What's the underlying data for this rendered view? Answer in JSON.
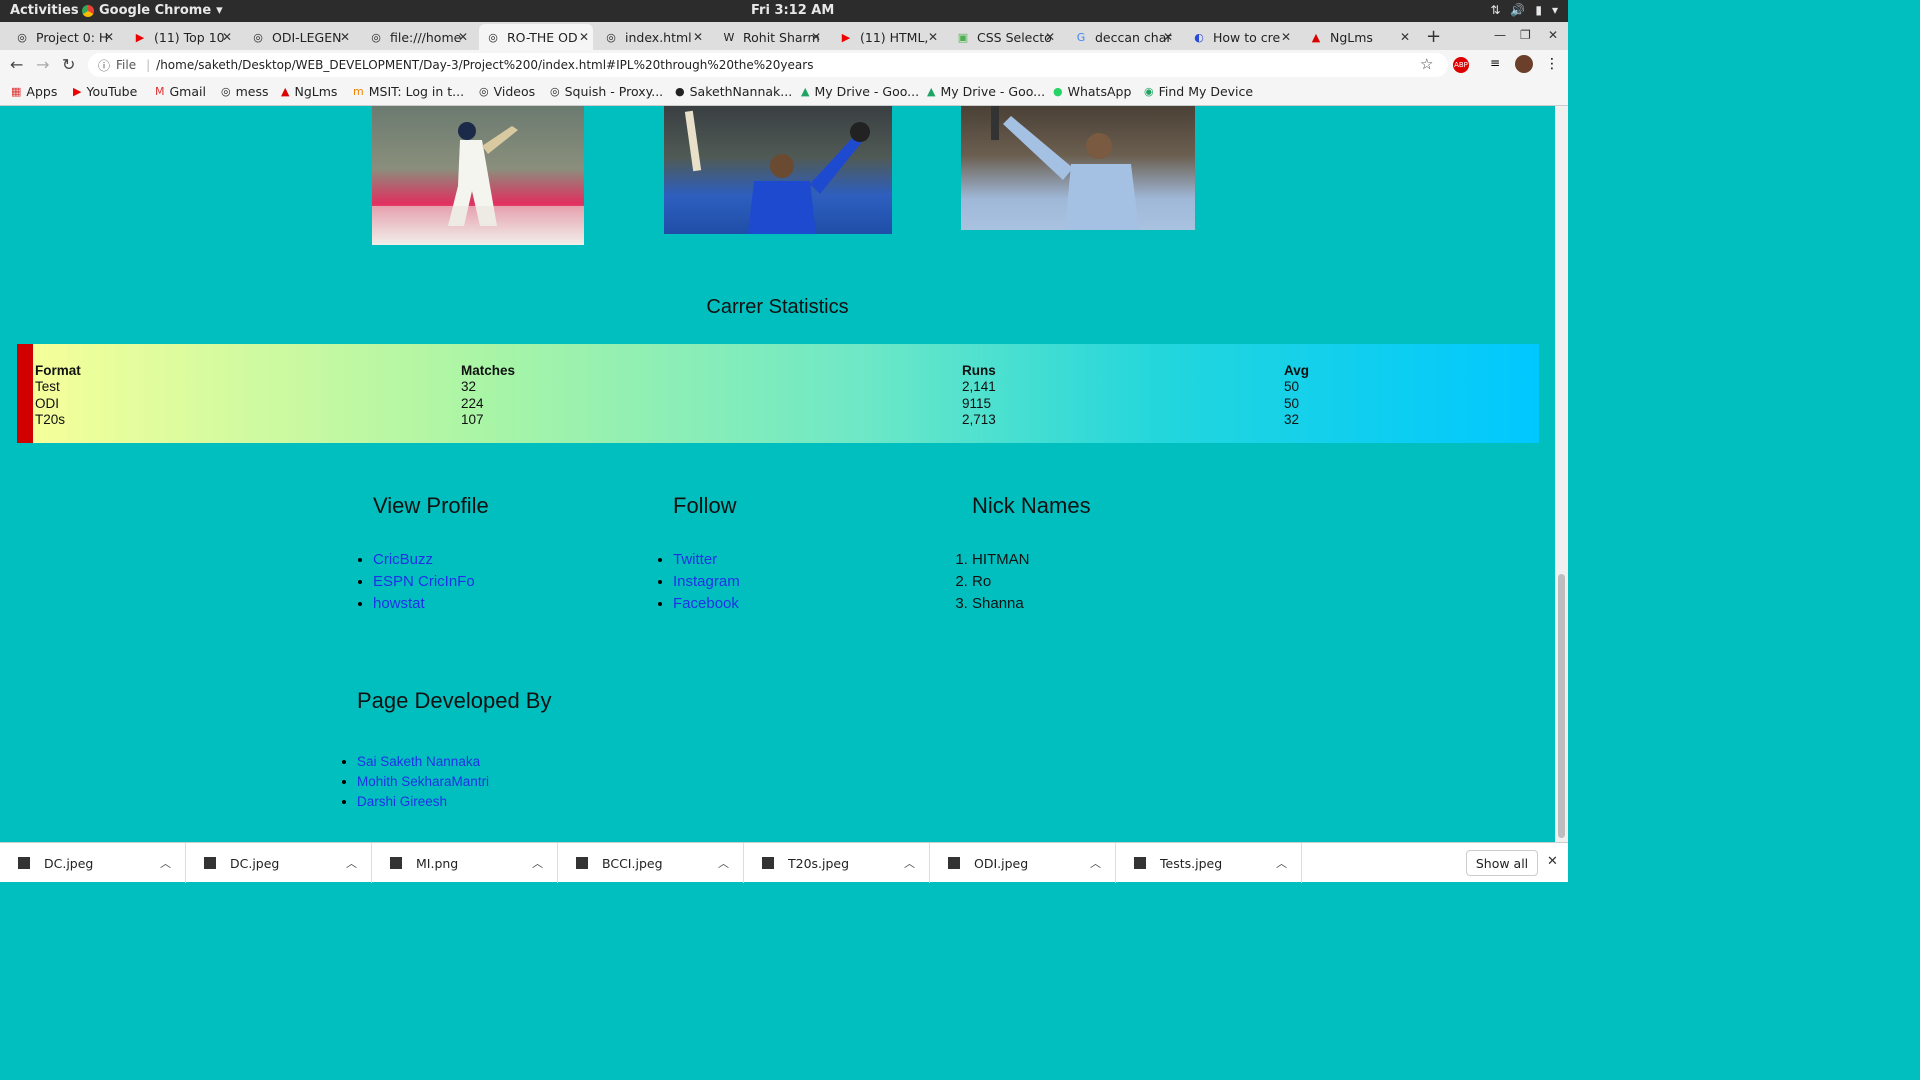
{
  "os": {
    "activities": "Activities",
    "app_name": "Google Chrome",
    "clock": "Fri  3:12 AM"
  },
  "tabs": [
    {
      "label": "Project 0: H",
      "icon": "globe-icon"
    },
    {
      "label": "(11) Top 10",
      "icon": "youtube-icon"
    },
    {
      "label": "ODI-LEGEN",
      "icon": "globe-icon"
    },
    {
      "label": "file:///home",
      "icon": "globe-icon"
    },
    {
      "label": "RO-THE OD",
      "icon": "globe-icon"
    },
    {
      "label": "index.html",
      "icon": "globe-icon"
    },
    {
      "label": "Rohit Sharm",
      "icon": "wikipedia-icon"
    },
    {
      "label": "(11) HTML,",
      "icon": "youtube-icon"
    },
    {
      "label": "CSS Selecto",
      "icon": "w3schools-icon"
    },
    {
      "label": "deccan char",
      "icon": "google-icon"
    },
    {
      "label": "How to cre",
      "icon": "globe-icon"
    },
    {
      "label": "NgLms",
      "icon": "angular-icon"
    }
  ],
  "address": {
    "file_label": "File",
    "url": "/home/saketh/Desktop/WEB_DEVELOPMENT/Day-3/Project%200/index.html#IPL%20through%20the%20years"
  },
  "bookmarks": [
    {
      "label": "Apps",
      "icon": "apps-grid-icon"
    },
    {
      "label": "YouTube",
      "icon": "youtube-icon"
    },
    {
      "label": "Gmail",
      "icon": "gmail-icon"
    },
    {
      "label": "mess",
      "icon": "globe-icon"
    },
    {
      "label": "NgLms",
      "icon": "angular-icon"
    },
    {
      "label": "MSIT: Log in t...",
      "icon": "moodle-icon"
    },
    {
      "label": "Videos",
      "icon": "globe-icon"
    },
    {
      "label": "Squish - Proxy...",
      "icon": "globe-icon"
    },
    {
      "label": "SakethNannak...",
      "icon": "github-icon"
    },
    {
      "label": "My Drive - Goo...",
      "icon": "drive-icon"
    },
    {
      "label": "My Drive - Goo...",
      "icon": "drive-icon"
    },
    {
      "label": "WhatsApp",
      "icon": "whatsapp-icon"
    },
    {
      "label": "Find My Device",
      "icon": "find-device-icon"
    }
  ],
  "stats": {
    "title": "Carrer Statistics",
    "headers": [
      "Format",
      "Matches",
      "Runs",
      "Avg"
    ],
    "rows": [
      [
        "Test",
        "32",
        "2,141",
        "50"
      ],
      [
        "ODI",
        "224",
        "9115",
        "50"
      ],
      [
        "T20s",
        "107",
        "2,713",
        "32"
      ]
    ]
  },
  "profile": {
    "title": "View Profile",
    "links": [
      "CricBuzz",
      "ESPN CricInFo",
      "howstat"
    ]
  },
  "follow": {
    "title": "Follow",
    "links": [
      "Twitter",
      "Instagram",
      "Facebook"
    ]
  },
  "nicknames": {
    "title": "Nick Names",
    "items": [
      "HITMAN",
      "Ro",
      "Shanna"
    ]
  },
  "developers": {
    "title": "Page Developed By",
    "names": [
      "Sai Saketh Nannaka",
      "Mohith SekharaMantri",
      "Darshi Gireesh"
    ]
  },
  "downloads": {
    "items": [
      "DC.jpeg",
      "DC.jpeg",
      "MI.png",
      "BCCI.jpeg",
      "T20s.jpeg",
      "ODI.jpeg",
      "Tests.jpeg"
    ],
    "show_all": "Show all"
  },
  "colors": {
    "page_bg": "#02bfbf",
    "table_border": "#d10000",
    "link": "#2130e6"
  }
}
